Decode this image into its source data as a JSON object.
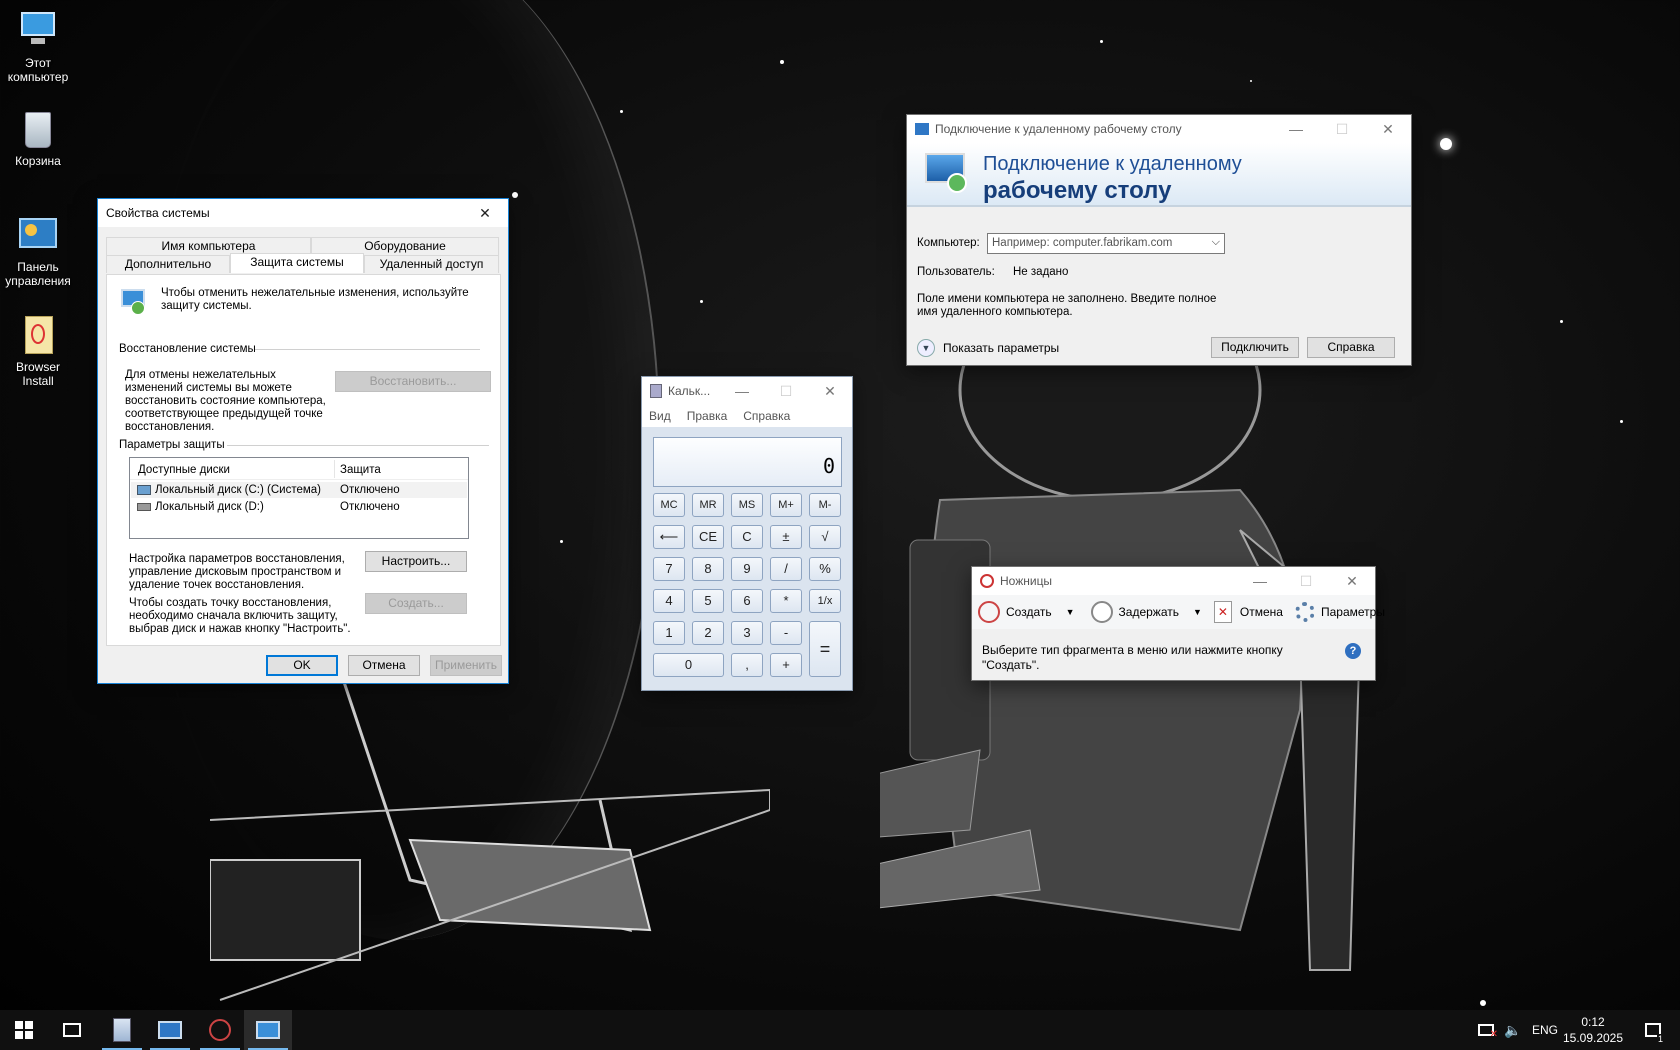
{
  "desktop": {
    "icons": [
      {
        "label": "Этот компьютер"
      },
      {
        "label": "Корзина"
      },
      {
        "label": "Панель управления"
      },
      {
        "label": "Browser Install"
      }
    ]
  },
  "system_props": {
    "title": "Свойства системы",
    "tabs_row1": [
      "Имя компьютера",
      "Оборудование"
    ],
    "tabs_row2": [
      "Дополнительно",
      "Защита системы",
      "Удаленный доступ"
    ],
    "intro": "Чтобы отменить нежелательные изменения, используйте защиту системы.",
    "restore_group": "Восстановление системы",
    "restore_text": "Для отмены нежелательных изменений системы вы можете восстановить состояние компьютера, соответствующее предыдущей точке восстановления.",
    "restore_button": "Восстановить...",
    "protection_group": "Параметры защиты",
    "col_drives": "Доступные диски",
    "col_protection": "Защита",
    "drives": [
      {
        "name": "Локальный диск (C:) (Система)",
        "status": "Отключено"
      },
      {
        "name": "Локальный диск (D:)",
        "status": "Отключено"
      }
    ],
    "configure_text": "Настройка параметров восстановления, управление дисковым пространством и удаление точек восстановления.",
    "configure_button": "Настроить...",
    "create_text": "Чтобы создать точку восстановления, необходимо сначала включить защиту, выбрав диск и нажав кнопку \"Настроить\".",
    "create_button": "Создать...",
    "ok": "OK",
    "cancel": "Отмена",
    "apply": "Применить"
  },
  "rdp": {
    "title": "Подключение к удаленному рабочему столу",
    "banner_line1": "Подключение к удаленному",
    "banner_line2": "рабочему столу",
    "computer_label": "Компьютер:",
    "computer_placeholder": "Например: computer.fabrikam.com",
    "user_label": "Пользователь:",
    "user_value": "Не задано",
    "warning": "Поле имени компьютера не заполнено. Введите полное имя удаленного компьютера.",
    "show_options": "Показать параметры",
    "connect": "Подключить",
    "help": "Справка"
  },
  "calc": {
    "title": "Кальк...",
    "menu": [
      "Вид",
      "Правка",
      "Справка"
    ],
    "display": "0",
    "keys_row1": [
      "MC",
      "MR",
      "MS",
      "M+",
      "M-"
    ],
    "keys_row2": [
      "⟵",
      "CE",
      "C",
      "±",
      "√"
    ],
    "keys_row3": [
      "7",
      "8",
      "9",
      "/",
      "%"
    ],
    "keys_row4": [
      "4",
      "5",
      "6",
      "*",
      "1/x"
    ],
    "keys_row5": [
      "1",
      "2",
      "3",
      "-"
    ],
    "key_zero": "0",
    "key_comma": ",",
    "key_plus": "+",
    "key_equals": "="
  },
  "snip": {
    "title": "Ножницы",
    "new": "Создать",
    "delay": "Задержать",
    "cancel": "Отмена",
    "options": "Параметры",
    "hint": "Выберите тип фрагмента в меню или нажмите кнопку \"Создать\"."
  },
  "taskbar": {
    "lang": "ENG",
    "time": "0:12",
    "date": "15.09.2025",
    "notif_count": "1"
  }
}
